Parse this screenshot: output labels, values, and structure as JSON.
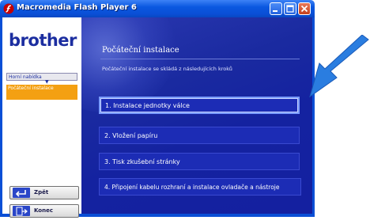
{
  "window": {
    "title": "Macromedia Flash Player 6",
    "icon": "flash-player-icon"
  },
  "sidebar": {
    "logo": "brother",
    "nav": {
      "home": "Horní nabídka",
      "current": "Počáteční instalace"
    },
    "buttons": {
      "back": "Zpět",
      "end": "Konec"
    }
  },
  "main": {
    "heading": "Počáteční instalace",
    "subtitle": "Počáteční instalace se skládá z následujících kroků",
    "options": [
      "1. Instalace jednotky válce",
      "2. Vložení papíru",
      "3. Tisk zkušební stránky",
      "4. Připojení kabelu rozhraní a instalace ovladače a nástroje"
    ]
  },
  "colors": {
    "titlebar": "#0a4fd6",
    "panel": "#1422a0",
    "accent": "#f4a012",
    "pointer_arrow": "#2a7de0"
  }
}
